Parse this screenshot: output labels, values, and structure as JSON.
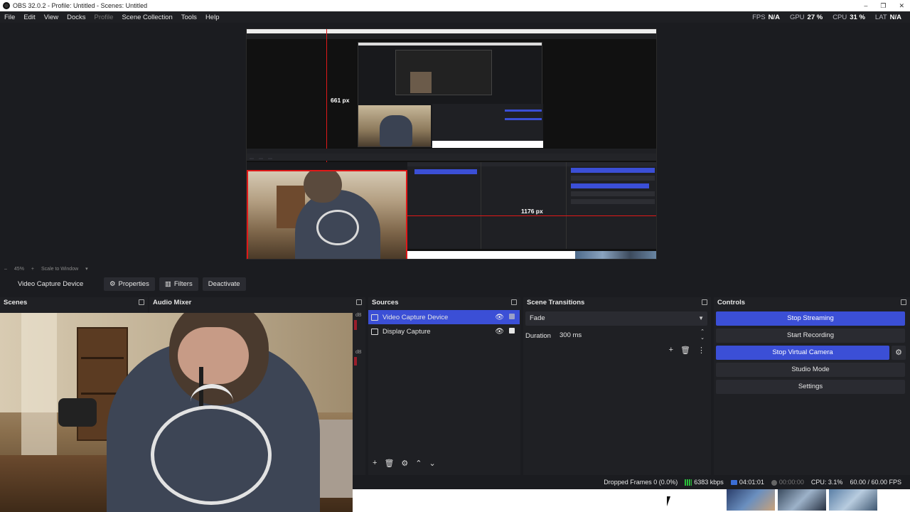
{
  "window": {
    "title": "OBS 32.0.2 - Profile: Untitled - Scenes: Untitled",
    "controls": [
      "–",
      "❐",
      "✕"
    ]
  },
  "menu": [
    "File",
    "Edit",
    "View",
    "Docks",
    "Profile",
    "Scene Collection",
    "Tools",
    "Help"
  ],
  "stats": {
    "fps_label": "FPS",
    "fps_value": "N/A",
    "gpu_label": "GPU",
    "gpu_value": "27 %",
    "cpu_label": "CPU",
    "cpu_value": "31 %",
    "lat_label": "LAT",
    "lat_value": "N/A"
  },
  "preview": {
    "measure_vertical": "661 px",
    "measure_horizontal": "1176 px",
    "colors": {
      "guide": "#e01818",
      "accent": "#3b4fd6"
    }
  },
  "zoom": {
    "level": "45%",
    "mode": "Scale to Window"
  },
  "source_toolbar": {
    "source_name": "Video Capture Device",
    "properties": "Properties",
    "filters": "Filters",
    "deactivate": "Deactivate"
  },
  "docks": {
    "scenes": {
      "title": "Scenes"
    },
    "audio_mixer": {
      "title": "Audio Mixer",
      "db_1": "dB",
      "db_2": "dB"
    },
    "sources": {
      "title": "Sources",
      "items": [
        {
          "label": "Video Capture Device",
          "icon": "camera-icon",
          "visible": true,
          "locked": false
        },
        {
          "label": "Display Capture",
          "icon": "monitor-icon",
          "visible": true,
          "locked": true
        }
      ]
    },
    "scene_transitions": {
      "title": "Scene Transitions",
      "transition": "Fade",
      "duration_label": "Duration",
      "duration_value": "300 ms"
    },
    "controls": {
      "title": "Controls",
      "stop_streaming": "Stop Streaming",
      "start_recording": "Start Recording",
      "stop_virtual_camera": "Stop Virtual Camera",
      "studio_mode": "Studio Mode",
      "settings": "Settings"
    }
  },
  "statusbar": {
    "dropped_frames": "Dropped Frames 0 (0.0%)",
    "bitrate": "6383 kbps",
    "stream_time": "04:01:01",
    "rec_time": "00:00:00",
    "cpu": "CPU: 3.1%",
    "fps": "60.00 / 60.00 FPS"
  }
}
